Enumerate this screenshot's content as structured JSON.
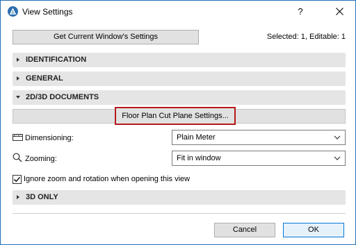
{
  "window": {
    "title": "View Settings",
    "help_label": "?"
  },
  "top": {
    "get_settings_label": "Get Current Window's Settings",
    "selected_info": "Selected: 1, Editable: 1"
  },
  "sections": {
    "identification": "IDENTIFICATION",
    "general": "GENERAL",
    "documents": "2D/3D DOCUMENTS",
    "three_d_only": "3D ONLY"
  },
  "documents": {
    "floor_plan_button": "Floor Plan Cut Plane Settings...",
    "dimensioning": {
      "label": "Dimensioning:",
      "value": "Plain Meter"
    },
    "zooming": {
      "label": "Zooming:",
      "value": "Fit in window"
    },
    "ignore_zoom": {
      "label": "Ignore zoom and rotation when opening this view",
      "checked": true
    }
  },
  "footer": {
    "cancel_label": "Cancel",
    "ok_label": "OK"
  },
  "colors": {
    "highlight": "#b5181a",
    "title_border": "#1f6fb5"
  }
}
